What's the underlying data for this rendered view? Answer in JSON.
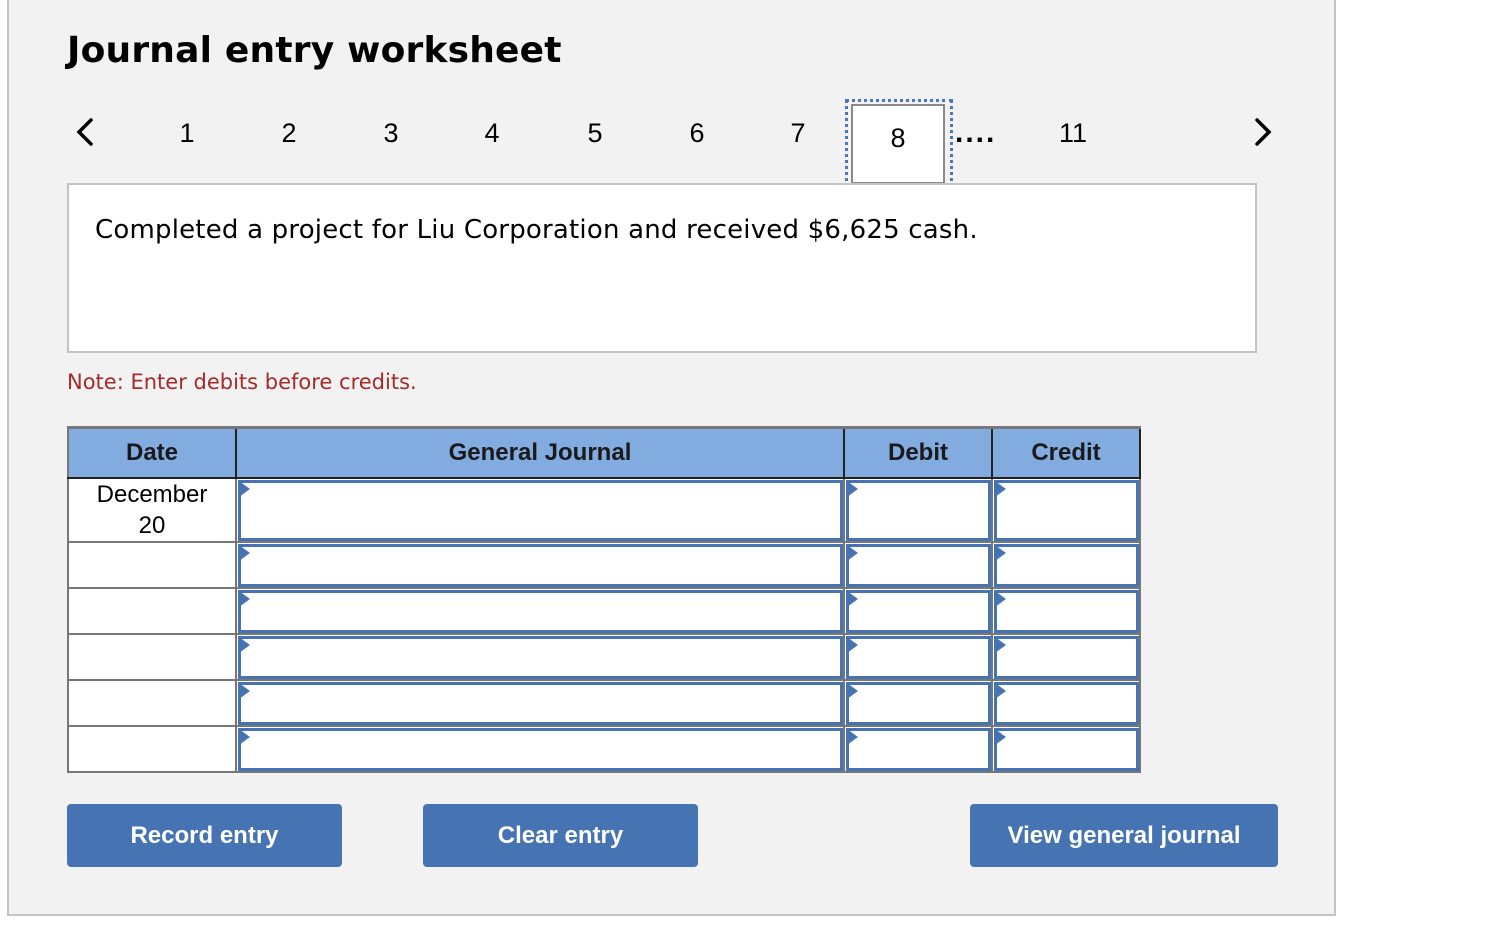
{
  "worksheet": {
    "title": "Journal entry worksheet",
    "nav": {
      "prev_icon": "chevron-left-icon",
      "next_icon": "chevron-right-icon",
      "pages": [
        "1",
        "2",
        "3",
        "4",
        "5",
        "6",
        "7",
        "8",
        "11"
      ],
      "active_page": "8",
      "ellipsis": "...."
    },
    "description": "Completed a project for Liu Corporation and received $6,625 cash.",
    "note": "Note: Enter debits before credits.",
    "table": {
      "headers": [
        "Date",
        "General Journal",
        "Debit",
        "Credit"
      ],
      "rows": [
        {
          "date": "December 20",
          "account": "",
          "debit": "",
          "credit": ""
        },
        {
          "date": "",
          "account": "",
          "debit": "",
          "credit": ""
        },
        {
          "date": "",
          "account": "",
          "debit": "",
          "credit": ""
        },
        {
          "date": "",
          "account": "",
          "debit": "",
          "credit": ""
        },
        {
          "date": "",
          "account": "",
          "debit": "",
          "credit": ""
        },
        {
          "date": "",
          "account": "",
          "debit": "",
          "credit": ""
        }
      ]
    },
    "buttons": {
      "record": "Record entry",
      "clear": "Clear entry",
      "view": "View general journal"
    },
    "colors": {
      "header_bg": "#82abe0",
      "button_bg": "#4674b2",
      "input_border": "#4674b2",
      "note_text": "#a52a2a",
      "panel_bg": "#f2f2f2"
    }
  }
}
